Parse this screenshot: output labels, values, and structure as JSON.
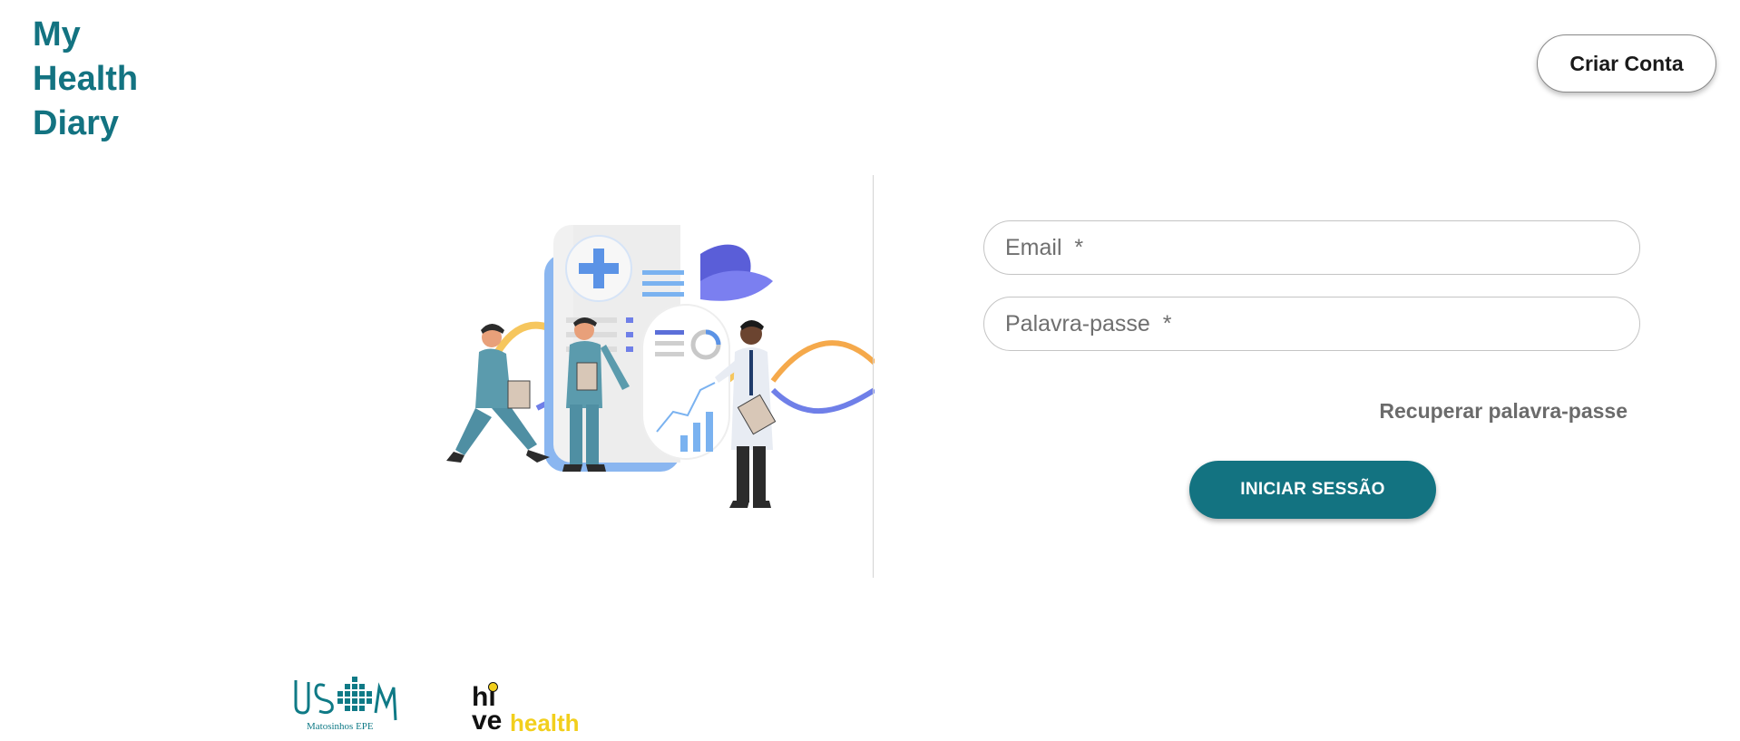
{
  "app": {
    "logo_lines": [
      "My",
      "Health",
      "Diary"
    ]
  },
  "header": {
    "create_account_label": "Criar Conta"
  },
  "login": {
    "email_placeholder": "Email  *",
    "password_placeholder": "Palavra-passe  *",
    "recover_label": "Recuperar palavra-passe",
    "submit_label": "INICIAR SESSÃO"
  },
  "footer": {
    "partner_logos": [
      {
        "name": "ULSM Matosinhos EPE",
        "text_main": "ULSM",
        "text_sub": "Matosinhos EPE"
      },
      {
        "name": "hive health",
        "hi": "hi",
        "ve": "ve",
        "health": "health"
      }
    ]
  },
  "colors": {
    "brand": "#137381",
    "button_text": "#ffffff",
    "link": "#6b6b6b",
    "accent_yellow": "#f2cf1c"
  }
}
